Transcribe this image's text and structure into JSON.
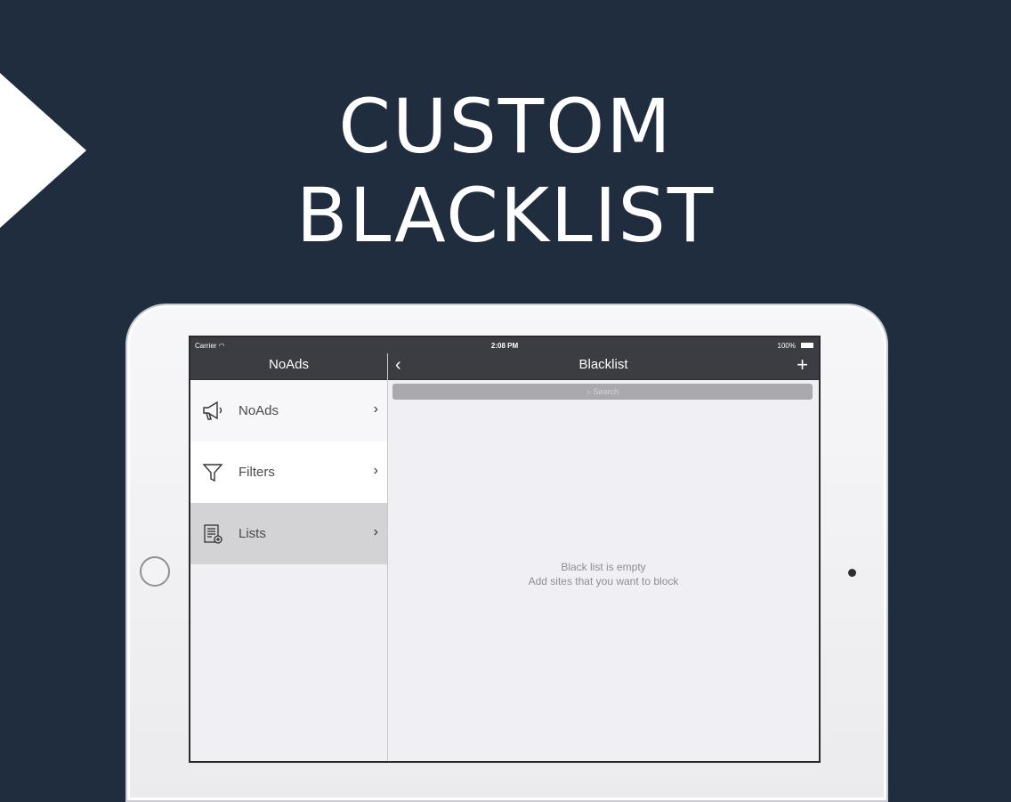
{
  "headline": {
    "line1": "CUSTOM",
    "line2": "BLACKLIST"
  },
  "status_bar": {
    "carrier": "Carrier",
    "time": "2:08 PM",
    "battery": "100%"
  },
  "sidebar": {
    "title": "NoAds",
    "items": [
      {
        "label": "NoAds",
        "icon": "megaphone-icon"
      },
      {
        "label": "Filters",
        "icon": "filter-icon"
      },
      {
        "label": "Lists",
        "icon": "list-icon"
      }
    ]
  },
  "main": {
    "title": "Blacklist",
    "search_placeholder": "Search",
    "empty_line1": "Black list is empty",
    "empty_line2": "Add sites that you want to block"
  },
  "colors": {
    "background": "#202d3f",
    "navbar": "#3b3d42",
    "selected_row": "#d3d3d6",
    "content_bg": "#efeff4"
  }
}
